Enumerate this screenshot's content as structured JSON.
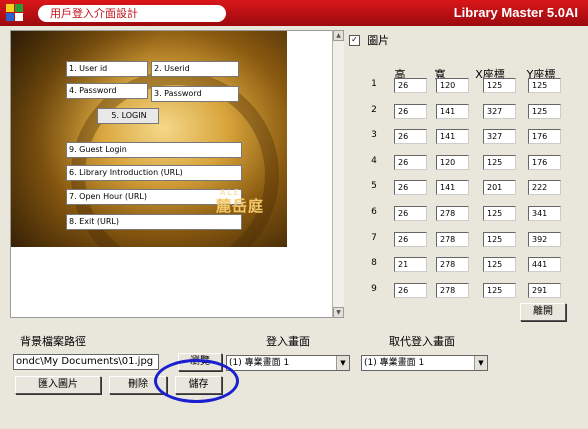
{
  "window": {
    "subtitle": "用戶登入介面設計",
    "app_name": "Library Master 5.0AI"
  },
  "preview": {
    "fields": [
      {
        "label": "1. User id"
      },
      {
        "label": "2. Userid"
      },
      {
        "label": "4. Password"
      },
      {
        "label": "3. Password"
      },
      {
        "label": "5. LOGIN"
      },
      {
        "label": "9. Guest Login"
      },
      {
        "label": "6. Library Introduction (URL)"
      },
      {
        "label": "7. Open Hour (URL)"
      },
      {
        "label": "8. Exit (URL)"
      }
    ],
    "brand_small": "ALE",
    "brand_large": "麓岳庭"
  },
  "image_checkbox": {
    "label": "圖片",
    "checked": true
  },
  "grid": {
    "headers": [
      "高",
      "寬",
      "X座標",
      "Y座標"
    ],
    "rows": [
      {
        "n": "1",
        "h": "26",
        "w": "120",
        "x": "125",
        "y": "125"
      },
      {
        "n": "2",
        "h": "26",
        "w": "141",
        "x": "327",
        "y": "125"
      },
      {
        "n": "3",
        "h": "26",
        "w": "141",
        "x": "327",
        "y": "176"
      },
      {
        "n": "4",
        "h": "26",
        "w": "120",
        "x": "125",
        "y": "176"
      },
      {
        "n": "5",
        "h": "26",
        "w": "141",
        "x": "201",
        "y": "222"
      },
      {
        "n": "6",
        "h": "26",
        "w": "278",
        "x": "125",
        "y": "341"
      },
      {
        "n": "7",
        "h": "26",
        "w": "278",
        "x": "125",
        "y": "392"
      },
      {
        "n": "8",
        "h": "21",
        "w": "278",
        "x": "125",
        "y": "441"
      },
      {
        "n": "9",
        "h": "26",
        "w": "278",
        "x": "125",
        "y": "291"
      }
    ]
  },
  "buttons": {
    "leave": "離開",
    "browse": "瀏覽",
    "import": "匯入圖片",
    "delete": "刪除",
    "save": "儲存"
  },
  "background_path": {
    "label": "背景檔案路徑",
    "value": "ondc\\My Documents\\01.jpg"
  },
  "login_screen": {
    "label": "登入畫面",
    "value": "(1) 專業畫面 1"
  },
  "replace_login_screen": {
    "label": "取代登入畫面",
    "value": "(1) 專業畫面 1"
  },
  "colors": {
    "title_bar": "#c1121a",
    "highlight_ellipse": "#1a1fd0"
  }
}
